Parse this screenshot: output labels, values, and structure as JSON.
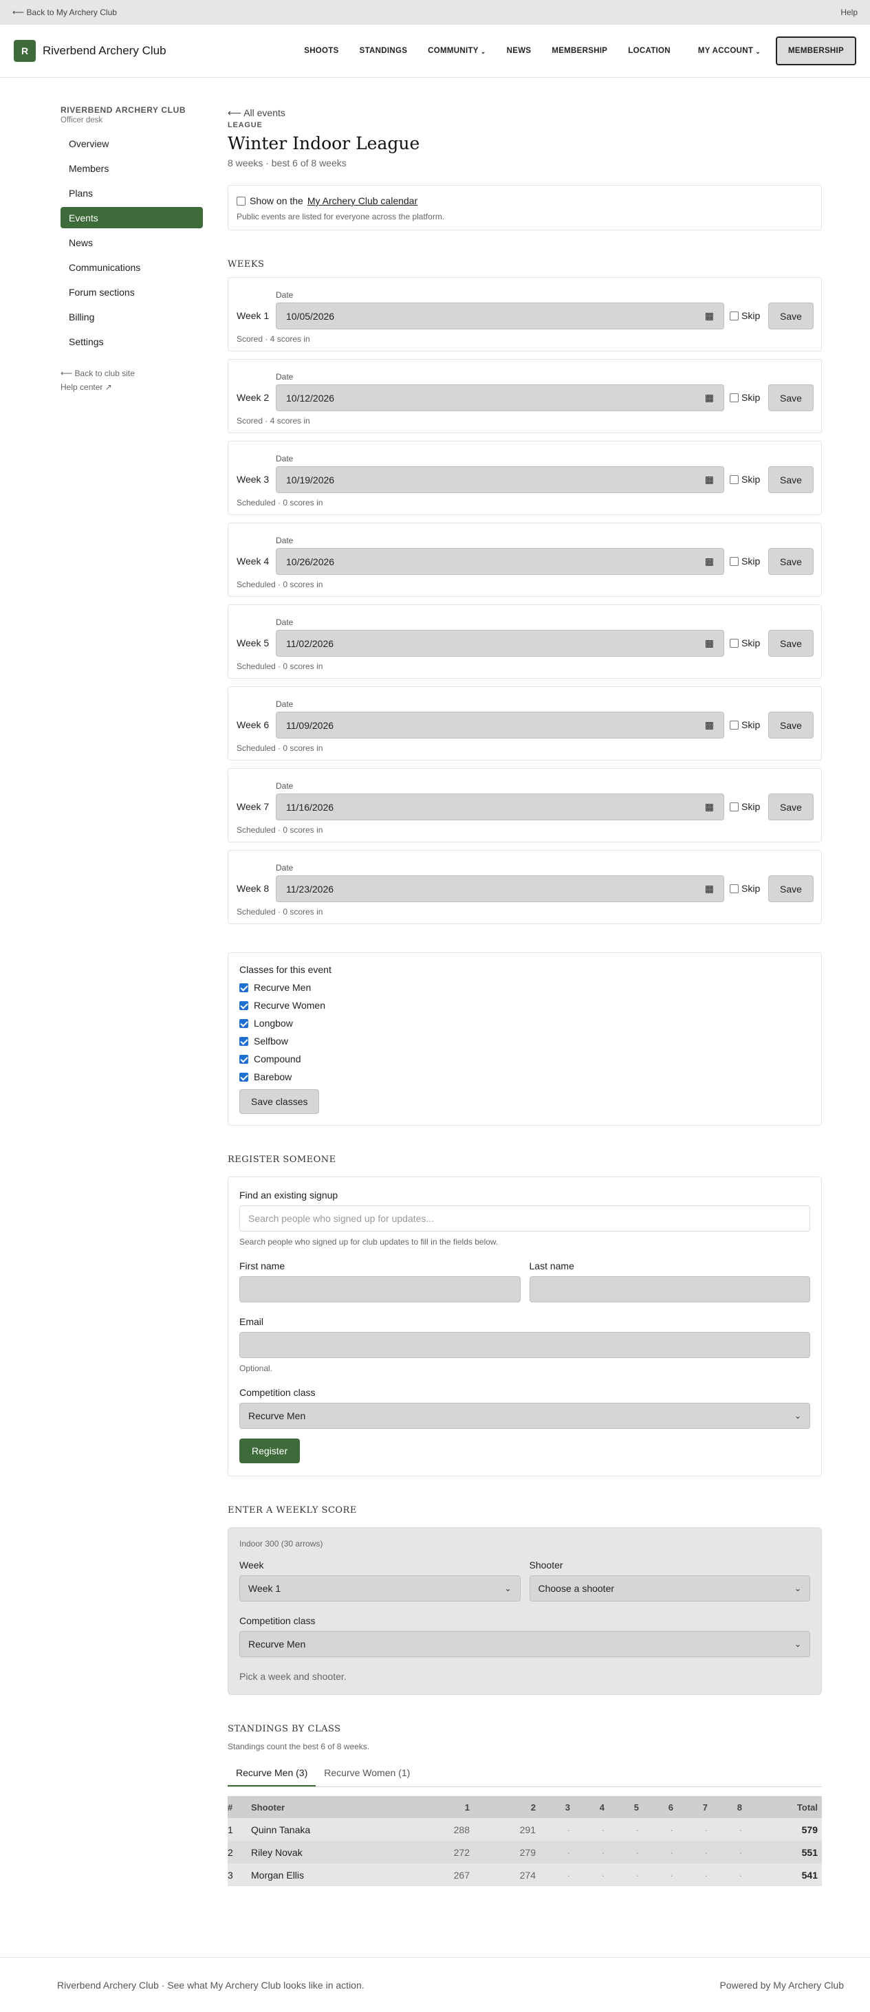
{
  "topbar": {
    "back": "⟵ Back to My Archery Club",
    "help": "Help"
  },
  "brand": {
    "logo_letter": "R",
    "name": "Riverbend Archery Club"
  },
  "nav": {
    "shoots": "SHOOTS",
    "standings": "STANDINGS",
    "community": "COMMUNITY",
    "news": "NEWS",
    "membership": "MEMBERSHIP",
    "location": "LOCATION",
    "my_account": "MY ACCOUNT",
    "membership_button": "MEMBERSHIP"
  },
  "sidebar": {
    "title": "RIVERBEND ARCHERY CLUB",
    "subtitle": "Officer desk",
    "items": [
      {
        "label": "Overview"
      },
      {
        "label": "Members"
      },
      {
        "label": "Plans"
      },
      {
        "label": "Events",
        "active": true
      },
      {
        "label": "News"
      },
      {
        "label": "Communications"
      },
      {
        "label": "Forum sections"
      },
      {
        "label": "Billing"
      },
      {
        "label": "Settings"
      }
    ],
    "back_site": "⟵ Back to club site",
    "help_center": "Help center ↗"
  },
  "event": {
    "back": "⟵ All events",
    "kicker": "LEAGUE",
    "title": "Winter Indoor League",
    "subtitle": "8 weeks · best 6 of 8 weeks"
  },
  "calendar": {
    "prefix": "Show on the",
    "link": "My Archery Club calendar",
    "hint": "Public events are listed for everyone across the platform."
  },
  "weeks_title": "WEEKS",
  "weeks": [
    {
      "label": "Week 1",
      "date_label": "Date",
      "date": "10/05/2026",
      "skip": "Skip",
      "save": "Save",
      "status": "Scored · 4 scores in"
    },
    {
      "label": "Week 2",
      "date_label": "Date",
      "date": "10/12/2026",
      "skip": "Skip",
      "save": "Save",
      "status": "Scored · 4 scores in"
    },
    {
      "label": "Week 3",
      "date_label": "Date",
      "date": "10/19/2026",
      "skip": "Skip",
      "save": "Save",
      "status": "Scheduled · 0 scores in"
    },
    {
      "label": "Week 4",
      "date_label": "Date",
      "date": "10/26/2026",
      "skip": "Skip",
      "save": "Save",
      "status": "Scheduled · 0 scores in"
    },
    {
      "label": "Week 5",
      "date_label": "Date",
      "date": "11/02/2026",
      "skip": "Skip",
      "save": "Save",
      "status": "Scheduled · 0 scores in"
    },
    {
      "label": "Week 6",
      "date_label": "Date",
      "date": "11/09/2026",
      "skip": "Skip",
      "save": "Save",
      "status": "Scheduled · 0 scores in"
    },
    {
      "label": "Week 7",
      "date_label": "Date",
      "date": "11/16/2026",
      "skip": "Skip",
      "save": "Save",
      "status": "Scheduled · 0 scores in"
    },
    {
      "label": "Week 8",
      "date_label": "Date",
      "date": "11/23/2026",
      "skip": "Skip",
      "save": "Save",
      "status": "Scheduled · 0 scores in"
    }
  ],
  "classes": {
    "title": "Classes for this event",
    "items": [
      "Recurve Men",
      "Recurve Women",
      "Longbow",
      "Selfbow",
      "Compound",
      "Barebow"
    ],
    "save": "Save classes"
  },
  "register": {
    "title": "REGISTER SOMEONE",
    "find_label": "Find an existing signup",
    "find_placeholder": "Search people who signed up for updates...",
    "find_hint": "Search people who signed up for club updates to fill in the fields below.",
    "first_name": "First name",
    "last_name": "Last name",
    "email": "Email",
    "email_hint": "Optional.",
    "class_label": "Competition class",
    "class_value": "Recurve Men",
    "button": "Register"
  },
  "score": {
    "title": "ENTER A WEEKLY SCORE",
    "format": "Indoor 300 (30 arrows)",
    "week_label": "Week",
    "week_value": "Week 1",
    "shooter_label": "Shooter",
    "shooter_value": "Choose a shooter",
    "class_label": "Competition class",
    "class_value": "Recurve Men",
    "hint": "Pick a week and shooter."
  },
  "standings": {
    "title": "STANDINGS BY CLASS",
    "note": "Standings count the best 6 of 8 weeks.",
    "tabs": [
      "Recurve Men (3)",
      "Recurve Women (1)"
    ],
    "columns": [
      "#",
      "Shooter",
      "1",
      "2",
      "3",
      "4",
      "5",
      "6",
      "7",
      "8",
      "Total"
    ],
    "rows": [
      {
        "rank": "1",
        "name": "Quinn Tanaka",
        "w": [
          "288",
          "291",
          "·",
          "·",
          "·",
          "·",
          "·",
          "·"
        ],
        "total": "579"
      },
      {
        "rank": "2",
        "name": "Riley Novak",
        "w": [
          "272",
          "279",
          "·",
          "·",
          "·",
          "·",
          "·",
          "·"
        ],
        "total": "551"
      },
      {
        "rank": "3",
        "name": "Morgan Ellis",
        "w": [
          "267",
          "274",
          "·",
          "·",
          "·",
          "·",
          "·",
          "·"
        ],
        "total": "541"
      }
    ]
  },
  "footer": {
    "left": "Riverbend Archery Club · See what My Archery Club looks like in action.",
    "right": "Powered by My Archery Club"
  }
}
